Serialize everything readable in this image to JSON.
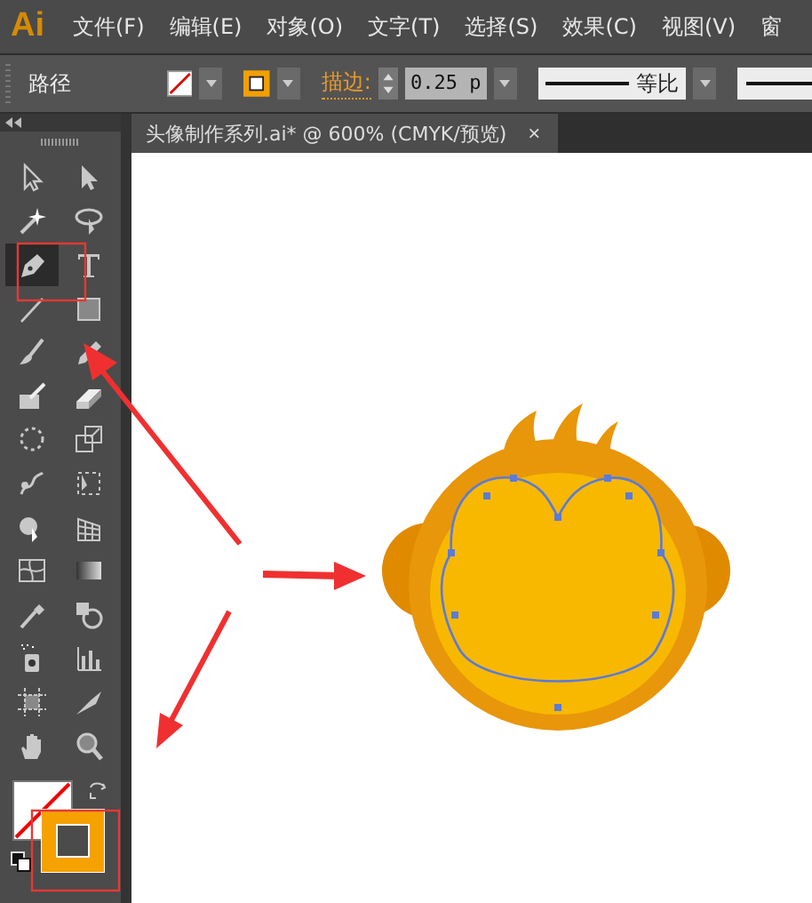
{
  "menu": {
    "logo": "Ai",
    "items": [
      "文件(F)",
      "编辑(E)",
      "对象(O)",
      "文字(T)",
      "选择(S)",
      "效果(C)",
      "视图(V)",
      "窗"
    ]
  },
  "control_bar": {
    "selection_label": "路径",
    "stroke_label": "描边:",
    "stroke_weight": "0.25 p",
    "profile": "等比"
  },
  "document_tab": {
    "title": "头像制作系列.ai* @ 600% (CMYK/预览)",
    "close": "×"
  },
  "tools": [
    {
      "kind": "selection",
      "selected": false
    },
    {
      "kind": "direct",
      "selected": false
    },
    {
      "kind": "wand",
      "selected": false
    },
    {
      "kind": "lasso",
      "selected": false
    },
    {
      "kind": "pen",
      "selected": true
    },
    {
      "kind": "type",
      "selected": false
    },
    {
      "kind": "line",
      "selected": false
    },
    {
      "kind": "rect",
      "selected": false
    },
    {
      "kind": "brush",
      "selected": false
    },
    {
      "kind": "pencil",
      "selected": false
    },
    {
      "kind": "blob",
      "selected": false
    },
    {
      "kind": "eraser",
      "selected": false
    },
    {
      "kind": "rotate",
      "selected": false
    },
    {
      "kind": "scale",
      "selected": false
    },
    {
      "kind": "warp",
      "selected": false
    },
    {
      "kind": "transform",
      "selected": false
    },
    {
      "kind": "builder",
      "selected": false
    },
    {
      "kind": "perspective",
      "selected": false
    },
    {
      "kind": "mesh",
      "selected": false
    },
    {
      "kind": "gradient",
      "selected": false
    },
    {
      "kind": "eyedropper",
      "selected": false
    },
    {
      "kind": "blend",
      "selected": false
    },
    {
      "kind": "spray",
      "selected": false
    },
    {
      "kind": "graph",
      "selected": false
    },
    {
      "kind": "artboard",
      "selected": false
    },
    {
      "kind": "slice",
      "selected": false
    },
    {
      "kind": "hand",
      "selected": false
    },
    {
      "kind": "zoom",
      "selected": false
    }
  ]
}
